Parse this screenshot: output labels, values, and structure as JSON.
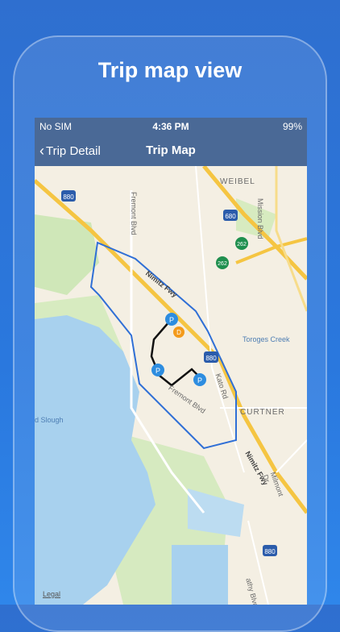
{
  "headline": "Trip map view",
  "status_bar": {
    "carrier": "No SIM",
    "time": "4:36 PM",
    "battery": "99%"
  },
  "nav": {
    "back_label": "Trip Detail",
    "title": "Trip Map"
  },
  "map": {
    "labels": {
      "weibel": "WEIBEL",
      "mission_blvd": "Mission Blvd",
      "fremont_blvd_top": "Fremont Blvd",
      "nimitz_fwy_top": "Nimitz Fwy",
      "toroges_creek": "Toroges Creek",
      "kato_rd": "Kato Rd",
      "fremont_blvd_mid": "Fremont Blvd",
      "curtner": "CURTNER",
      "slough": "d Slough",
      "nimitz_fwy_bottom": "Nimitz Fwy",
      "milmont_dr": "Milmont Dr",
      "cathy_blvd": "athy Blvd"
    },
    "shields": {
      "i880_top": "880",
      "i680": "680",
      "r262_a": "262",
      "r262_b": "262",
      "i880_mid": "880",
      "i880_bottom": "880"
    },
    "pins": {
      "p1": "P",
      "d": "D",
      "p2": "P",
      "p3": "P"
    },
    "legal": "Legal"
  },
  "colors": {
    "nav_bg": "#4a6996",
    "boundary": "#2f6fd6",
    "route": "#111111",
    "water": "#a8d1ee",
    "pin_blue": "#2d8de0",
    "pin_orange": "#f39a1b"
  }
}
